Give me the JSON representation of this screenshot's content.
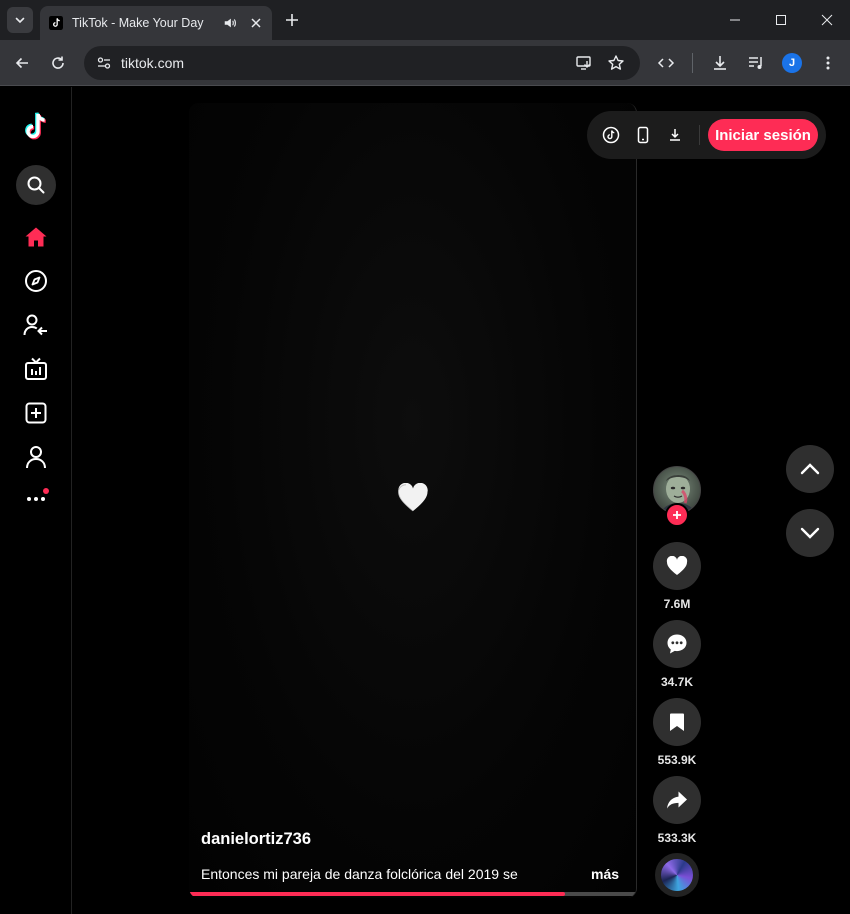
{
  "browser": {
    "tab_title": "TikTok - Make Your Day",
    "url": "tiktok.com",
    "profile_initial": "J"
  },
  "icons": {
    "tab_search": "chevron-down-icon",
    "favicon": "tiktok-logo-icon",
    "audio": "speaker-icon",
    "close": "close-icon",
    "new_tab": "plus-icon",
    "back": "arrow-left-icon",
    "reload": "reload-icon",
    "site_info": "tune-icon",
    "install": "install-app-icon",
    "bookmark": "star-icon",
    "devtools": "code-icon",
    "downloads": "download-icon",
    "media": "media-controls-icon",
    "menu": "kebab-menu-icon"
  },
  "sidebar": {
    "items": [
      "logo",
      "search",
      "home",
      "explore",
      "following",
      "live",
      "upload",
      "profile",
      "more"
    ]
  },
  "top_actions": {
    "login_label": "Iniciar sesión"
  },
  "video": {
    "author": "danielortiz736",
    "caption": "Entonces mi pareja de danza folclórica del 2019 se",
    "more_label": "más",
    "progress_fraction": 0.84
  },
  "actions": {
    "likes": "7.6M",
    "comments": "34.7K",
    "saves": "553.9K",
    "shares": "533.3K"
  },
  "colors": {
    "accent": "#fe2c55",
    "chrome_dark": "#1f2023",
    "chrome_toolbar": "#35363a"
  }
}
